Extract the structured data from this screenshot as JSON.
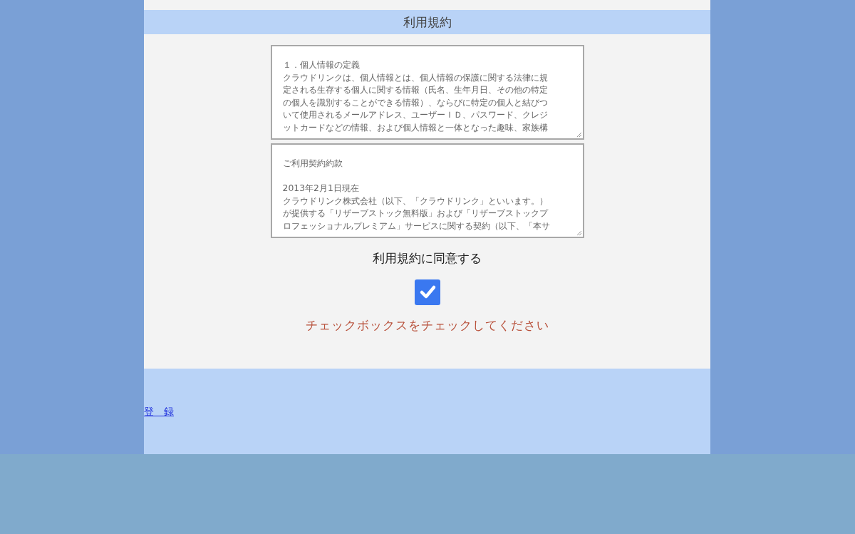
{
  "header": {
    "title": "利用規約"
  },
  "terms_boxes": [
    {
      "paragraphs": [
        [
          "１．個人情報の定義",
          "クラウドリンクは、個人情報とは、個人情報の保護に関する法律に規",
          "定される生存する個人に関する情報（氏名、生年月日、その他の特定",
          "の個人を識別することができる情報）、ならびに特定の個人と結びつ",
          "いて使用されるメールアドレス、ユーザーＩＤ、パスワード、クレジ",
          "ットカードなどの情報、および個人情報と一体となった趣味、家族構"
        ]
      ]
    },
    {
      "paragraphs": [
        [
          "ご利用契約約款"
        ],
        [
          "2013年2月1日現在",
          "クラウドリンク株式会社（以下、「クラウドリンク」といいます。）",
          "が提供する「リザーブストック無料版」および「リザーブストックプ",
          "ロフェッショナル,プレミアム」サービスに関する契約（以下、「本サ"
        ]
      ]
    }
  ],
  "agree": {
    "label": "利用規約に同意する",
    "checked": true
  },
  "error": "チェックボックスをチェックしてください",
  "register_link": "登　録"
}
